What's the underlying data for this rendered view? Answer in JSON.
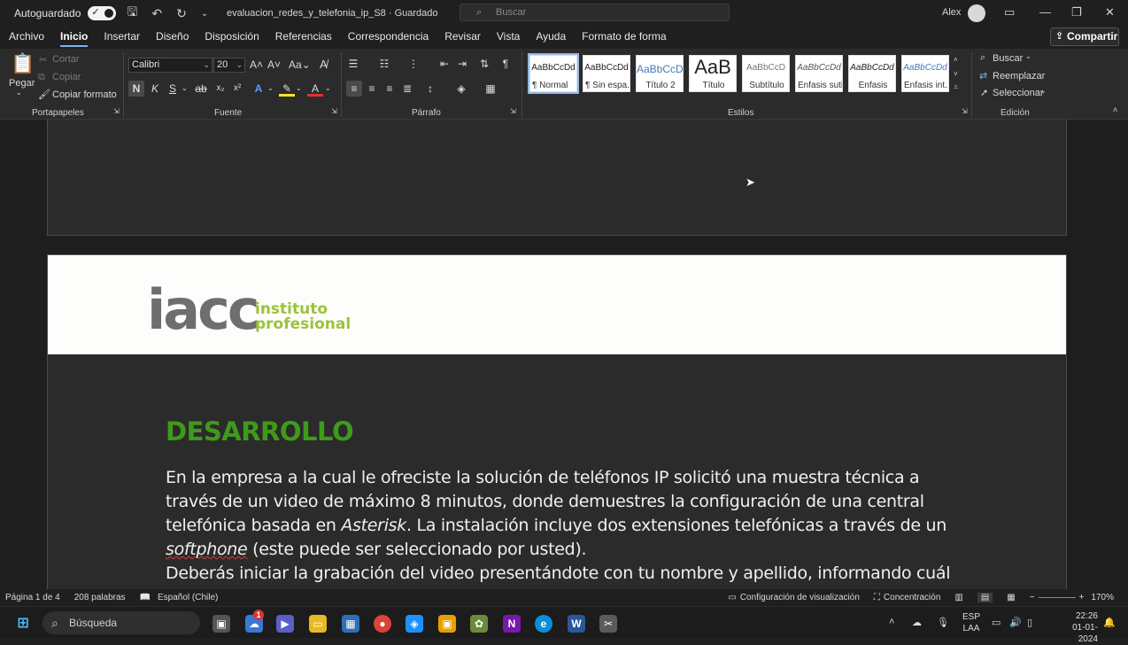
{
  "titlebar": {
    "autosave_label": "Autoguardado",
    "doc_title": "evaluacion_redes_y_telefonia_ip_S8 · Guardado",
    "search_placeholder": "Buscar",
    "user_name": "Alex"
  },
  "tabs": [
    "Archivo",
    "Inicio",
    "Insertar",
    "Diseño",
    "Disposición",
    "Referencias",
    "Correspondencia",
    "Revisar",
    "Vista",
    "Ayuda",
    "Formato de forma"
  ],
  "active_tab": "Inicio",
  "share_label": "Compartir",
  "ribbon": {
    "clipboard": {
      "paste": "Pegar",
      "cut": "Cortar",
      "copy": "Copiar",
      "format_painter": "Copiar formato",
      "label": "Portapapeles"
    },
    "font": {
      "name": "Calibri",
      "size": "20",
      "label": "Fuente",
      "bold": "N",
      "italic": "K",
      "underline": "S"
    },
    "paragraph": {
      "label": "Párrafo"
    },
    "styles": {
      "label": "Estilos",
      "items": [
        {
          "sample": "AaBbCcDd",
          "name": "¶ Normal"
        },
        {
          "sample": "AaBbCcDd",
          "name": "¶ Sin espa..."
        },
        {
          "sample": "AaBbCcD",
          "name": "Título 2"
        },
        {
          "sample": "AaB",
          "name": "Título"
        },
        {
          "sample": "AaBbCcD",
          "name": "Subtítulo"
        },
        {
          "sample": "AaBbCcDd",
          "name": "Énfasis sutil"
        },
        {
          "sample": "AaBbCcDd",
          "name": "Énfasis"
        },
        {
          "sample": "AaBbCcDd",
          "name": "Énfasis int..."
        }
      ]
    },
    "editing": {
      "find": "Buscar",
      "replace": "Reemplazar",
      "select": "Seleccionar",
      "label": "Edición"
    }
  },
  "document": {
    "logo_main": "iacc",
    "logo_sub1": "instituto",
    "logo_sub2": "profesional",
    "heading": "DESARROLLO",
    "p1_a": "En la empresa a la cual le ofreciste la solución de teléfonos IP solicitó una muestra técnica a través de un video de máximo 8 minutos, donde demuestres la configuración de una central telefónica basada en ",
    "p1_b": "Asterisk",
    "p1_c": ". La instalación incluye dos extensiones telefónicas a través de un ",
    "p1_d": "softphone",
    "p1_e": " (este puede ser seleccionado por usted).",
    "p2": "Deberás iniciar la grabación del video presentándote con tu nombre y apellido, informando cuál"
  },
  "statusbar": {
    "page": "Página 1 de 4",
    "words": "208 palabras",
    "language": "Español (Chile)",
    "display_settings": "Configuración de visualización",
    "focus": "Concentración",
    "zoom": "170%"
  },
  "taskbar": {
    "search": "Búsqueda",
    "lang1": "ESP",
    "lang2": "LAA",
    "time": "22:26",
    "date": "01-01-2024",
    "badge": "1"
  }
}
